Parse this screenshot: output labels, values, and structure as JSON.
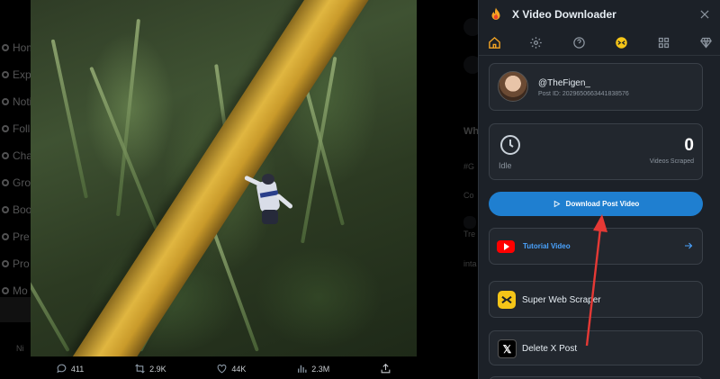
{
  "twitter": {
    "nav_items": [
      {
        "label": "Hom",
        "icon": "home-icon"
      },
      {
        "label": "Expl",
        "icon": "explore-icon"
      },
      {
        "label": "Noti",
        "icon": "notifications-icon"
      },
      {
        "label": "Foll",
        "icon": "following-icon"
      },
      {
        "label": "Cha",
        "icon": "chat-icon"
      },
      {
        "label": "Gro",
        "icon": "grok-icon"
      },
      {
        "label": "Boo",
        "icon": "bookmarks-icon"
      },
      {
        "label": "Pre",
        "icon": "premium-icon"
      },
      {
        "label": "Pro",
        "icon": "profile-icon"
      },
      {
        "label": "Mo",
        "icon": "more-icon"
      }
    ],
    "profile_hint": "Ni",
    "right_ghost": [
      "Wh",
      "#G",
      "Co",
      "Tre",
      "inta"
    ],
    "actions": [
      {
        "icon": "reply-icon",
        "count": "411"
      },
      {
        "icon": "retweet-icon",
        "count": "2.9K"
      },
      {
        "icon": "like-icon",
        "count": "44K"
      },
      {
        "icon": "views-icon",
        "count": "2.3M"
      },
      {
        "icon": "share-icon",
        "count": ""
      }
    ]
  },
  "extension": {
    "title": "X Video Downloader",
    "tabs": [
      "home-icon",
      "settings-icon",
      "help-icon",
      "scraper-icon",
      "apps-icon",
      "premium-diamond-icon"
    ],
    "active_tab": "home-icon",
    "profile": {
      "handle": "@TheFigen_",
      "post_id": "Post ID: 2029650663441838576"
    },
    "stats": {
      "status": "Idle",
      "count": "0",
      "count_label": "Videos Scraped"
    },
    "download_button": "Download Post Video",
    "tutorial": "Tutorial Video",
    "scraper": "Super Web Scraper",
    "delete": "Delete X Post"
  },
  "colors": {
    "accent": "#1f7fd0",
    "panel_bg": "#1c2128",
    "card_bg": "#22272e",
    "annotation": "#e53935",
    "brand_orange": "#f5a524"
  }
}
